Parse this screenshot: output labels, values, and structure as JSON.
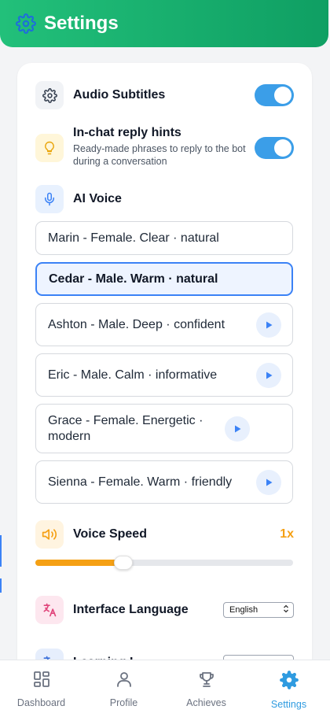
{
  "header": {
    "title": "Settings",
    "icon": "gear-icon"
  },
  "settings": {
    "audio_subtitles": {
      "label": "Audio Subtitles",
      "enabled": true
    },
    "reply_hints": {
      "label": "In-chat reply hints",
      "description": "Ready-made phrases to reply to the bot during a conversation",
      "enabled": true
    },
    "ai_voice": {
      "label": "AI Voice",
      "voices": [
        {
          "name": "Marin - Female. Clear · natural",
          "selected": false,
          "play": false
        },
        {
          "name": "Cedar - Male. Warm · natural",
          "selected": true,
          "play": false
        },
        {
          "name": "Ashton - Male. Deep · confident",
          "selected": false,
          "play": true
        },
        {
          "name": "Eric - Male. Calm · informative",
          "selected": false,
          "play": true
        },
        {
          "name": "Grace - Female. Energetic · modern",
          "selected": false,
          "play": true
        },
        {
          "name": "Sienna - Female. Warm · friendly",
          "selected": false,
          "play": true
        }
      ]
    },
    "voice_speed": {
      "label": "Voice Speed",
      "value": "1x",
      "fill_fraction": 0.34
    },
    "interface_language": {
      "label": "Interface Language",
      "selected": "English"
    },
    "learning_language": {
      "label": "Learning L"
    }
  },
  "colors": {
    "accent": "#2f9be0",
    "header_start": "#22c07a",
    "header_end": "#0f9f63",
    "speed": "#f5a014",
    "toggle": "#3b9ee8"
  },
  "tabs": [
    {
      "label": "Dashboard",
      "icon": "dashboard-icon",
      "active": false
    },
    {
      "label": "Profile",
      "icon": "profile-icon",
      "active": false
    },
    {
      "label": "Achieves",
      "icon": "trophy-icon",
      "active": false
    },
    {
      "label": "Settings",
      "icon": "gear-icon",
      "active": true
    }
  ]
}
